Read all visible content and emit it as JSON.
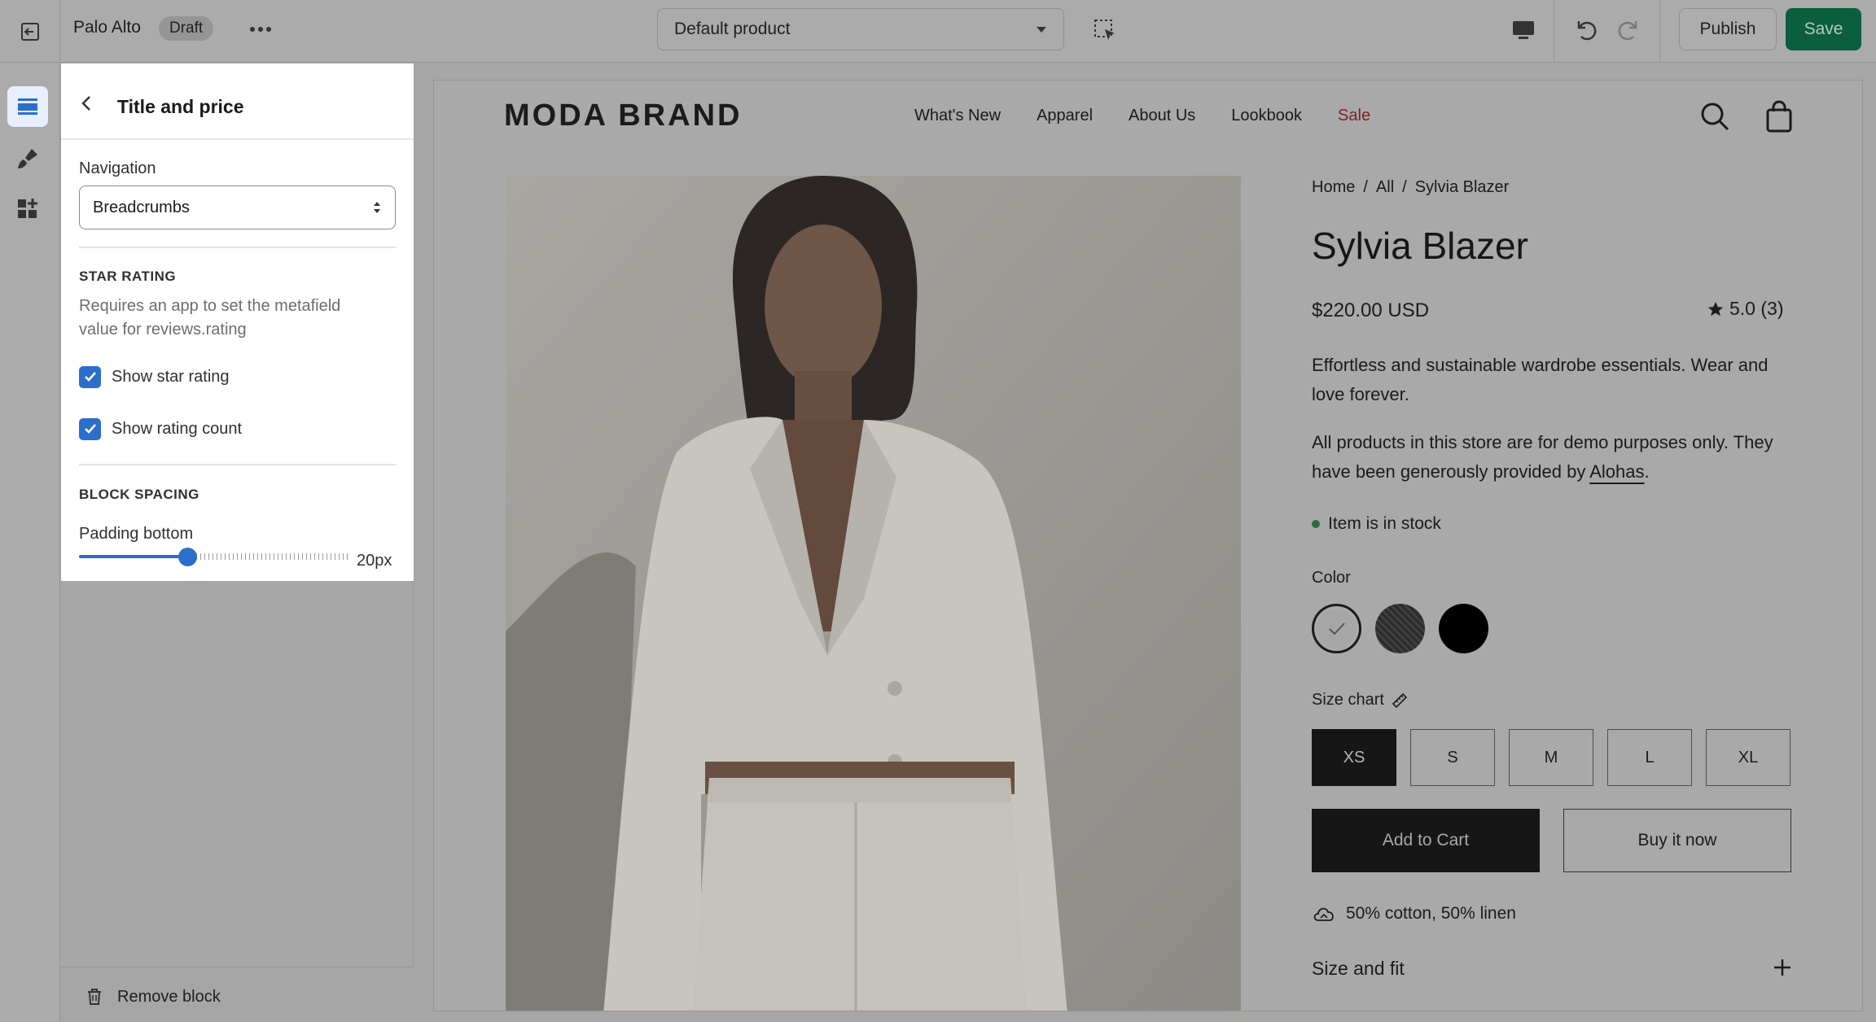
{
  "topbar": {
    "store_name": "Palo Alto",
    "status_badge": "Draft",
    "template_select": "Default product",
    "publish_label": "Publish",
    "save_label": "Save"
  },
  "panel": {
    "title": "Title and price",
    "navigation_label": "Navigation",
    "navigation_value": "Breadcrumbs",
    "star_rating_heading": "STAR RATING",
    "star_rating_help": "Requires an app to set the metafield value for reviews.rating",
    "show_star_rating_label": "Show star rating",
    "show_star_rating_checked": true,
    "show_rating_count_label": "Show rating count",
    "show_rating_count_checked": true,
    "block_spacing_heading": "BLOCK SPACING",
    "padding_bottom_label": "Padding bottom",
    "padding_bottom_value": "20px",
    "padding_bottom_fraction": 0.4,
    "remove_block_label": "Remove block"
  },
  "store": {
    "logo": "MODA BRAND",
    "nav": [
      "What's New",
      "Apparel",
      "About Us",
      "Lookbook",
      "Sale"
    ],
    "breadcrumbs": [
      "Home",
      "/",
      "All",
      "/",
      "Sylvia Blazer"
    ],
    "product_title": "Sylvia Blazer",
    "price": "$220.00 USD",
    "rating": "5.0 (3)",
    "description_1": "Effortless and sustainable wardrobe essentials. Wear and love forever.",
    "description_2_prefix": "All products in this store are for demo purposes only. They have been generously provided by ",
    "description_2_link": "Alohas",
    "description_2_suffix": ".",
    "stock": "Item is in stock",
    "color_label": "Color",
    "size_chart_label": "Size chart",
    "sizes": [
      "XS",
      "S",
      "M",
      "L",
      "XL"
    ],
    "selected_size": "XS",
    "add_to_cart": "Add to Cart",
    "buy_now": "Buy it now",
    "material": "50% cotton, 50% linen",
    "size_and_fit": "Size and fit"
  },
  "colors": {
    "accent_blue": "#2c6ecb",
    "save_green": "#0b5e3f",
    "sale_red": "#7a2424"
  }
}
